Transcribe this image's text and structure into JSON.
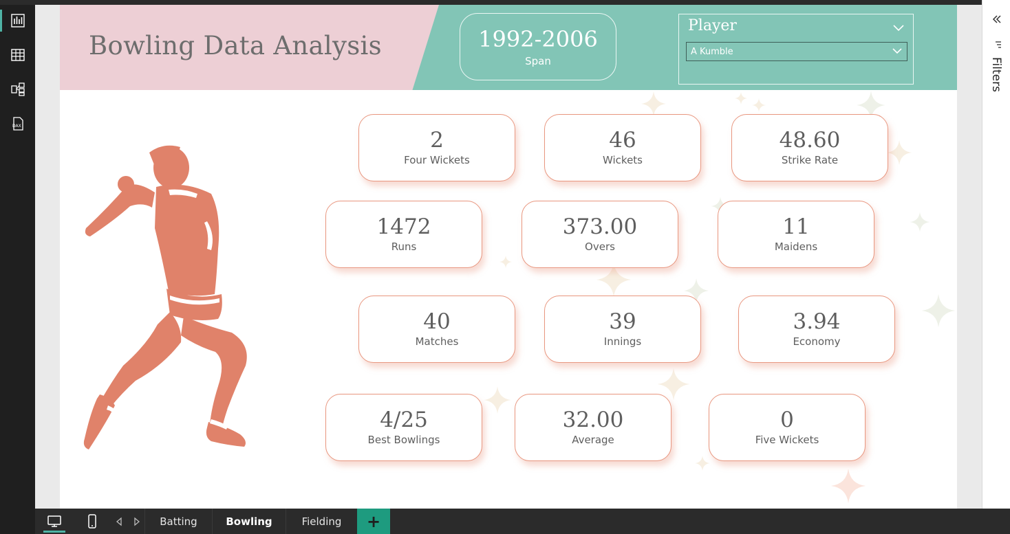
{
  "rail": {
    "items": [
      {
        "name": "report-view-icon",
        "active": true
      },
      {
        "name": "table-view-icon",
        "active": false
      },
      {
        "name": "model-view-icon",
        "active": false
      },
      {
        "name": "dax-query-icon",
        "active": false,
        "text": "DAX"
      }
    ]
  },
  "header": {
    "title": "Bowling Data Analysis",
    "span": {
      "value": "1992-2006",
      "label": "Span"
    },
    "slicer": {
      "label": "Player",
      "selected": "A Kumble"
    }
  },
  "kpis": [
    {
      "value": "2",
      "label": "Four Wickets"
    },
    {
      "value": "46",
      "label": "Wickets"
    },
    {
      "value": "48.60",
      "label": "Strike Rate"
    },
    {
      "value": "1472",
      "label": "Runs"
    },
    {
      "value": "373.00",
      "label": "Overs"
    },
    {
      "value": "11",
      "label": "Maidens"
    },
    {
      "value": "40",
      "label": "Matches"
    },
    {
      "value": "39",
      "label": "Innings"
    },
    {
      "value": "3.94",
      "label": "Economy"
    },
    {
      "value": "4/25",
      "label": "Best Bowlings"
    },
    {
      "value": "32.00",
      "label": "Average"
    },
    {
      "value": "0",
      "label": "Five Wickets"
    }
  ],
  "filters_pane": {
    "label": "Filters"
  },
  "pages": {
    "tabs": [
      {
        "label": "Batting",
        "active": false
      },
      {
        "label": "Bowling",
        "active": true
      },
      {
        "label": "Fielding",
        "active": false
      }
    ],
    "add_label": "+"
  },
  "colors": {
    "teal": "#82c5b6",
    "pink": "#edcfd5",
    "accent": "#e8967f",
    "figure": "#e0826a",
    "text": "#5e5e5e"
  }
}
